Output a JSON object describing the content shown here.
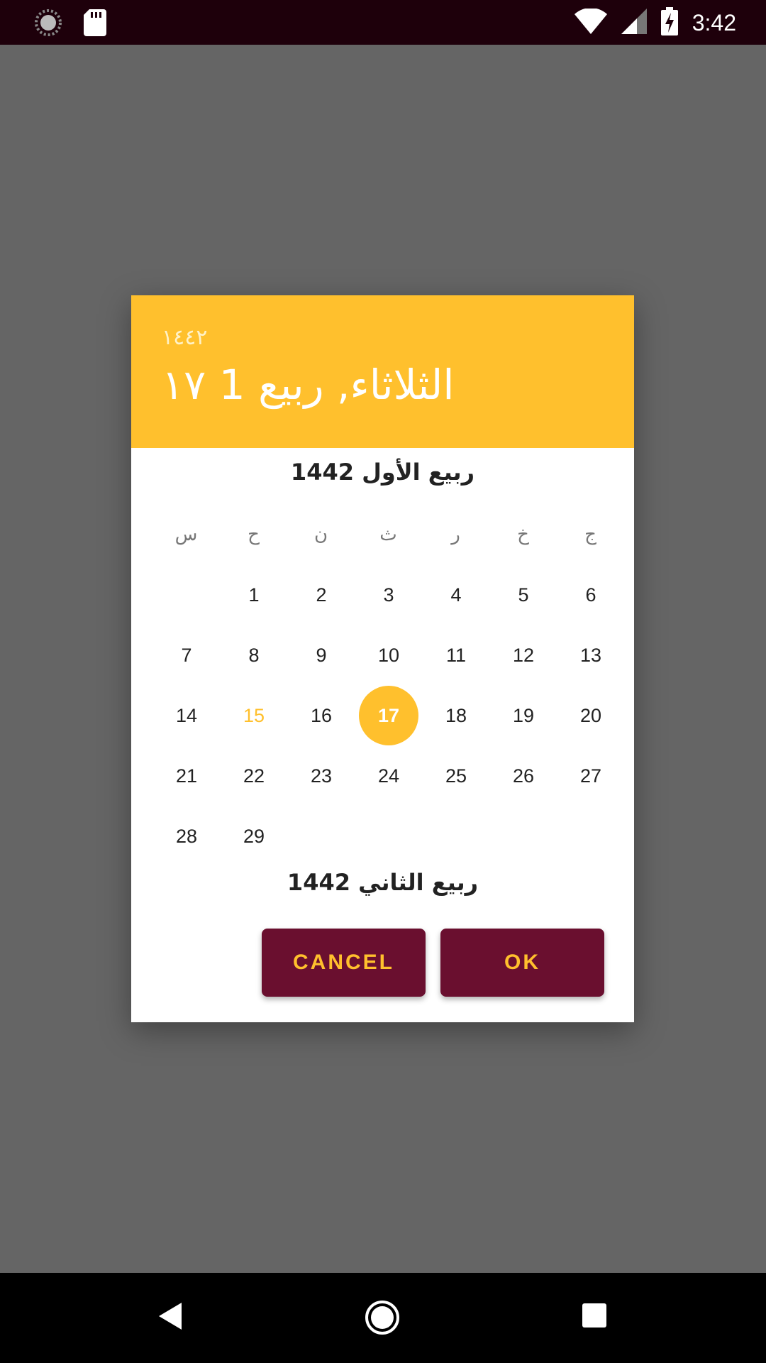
{
  "status_bar": {
    "time": "3:42",
    "icons": [
      "loading-icon",
      "sd-card-icon",
      "wifi-icon",
      "signal-icon",
      "battery-charging-icon"
    ]
  },
  "dialog": {
    "header": {
      "year": "١٤٤٢",
      "date": "الثلاثاء, ربيع 1 ١٧"
    },
    "month_title": "ربيع الأول 1442",
    "weekdays": [
      "س",
      "ح",
      "ن",
      "ث",
      "ر",
      "خ",
      "ج"
    ],
    "weeks": [
      [
        "",
        "1",
        "2",
        "3",
        "4",
        "5",
        "6"
      ],
      [
        "7",
        "8",
        "9",
        "10",
        "11",
        "12",
        "13"
      ],
      [
        "14",
        "15",
        "16",
        "17",
        "18",
        "19",
        "20"
      ],
      [
        "21",
        "22",
        "23",
        "24",
        "25",
        "26",
        "27"
      ],
      [
        "28",
        "29",
        "",
        "",
        "",
        "",
        ""
      ]
    ],
    "today_day": "15",
    "selected_day": "17",
    "next_month_title": "ربيع الثاني 1442",
    "cancel_label": "CANCEL",
    "ok_label": "OK"
  },
  "colors": {
    "accent": "#ffc02d",
    "button_bg": "#6a0f2f",
    "status_bar_bg": "#1e000b",
    "scrim": "#656565"
  },
  "nav_bar": {
    "icons": [
      "back-icon",
      "home-icon",
      "recents-icon"
    ]
  }
}
